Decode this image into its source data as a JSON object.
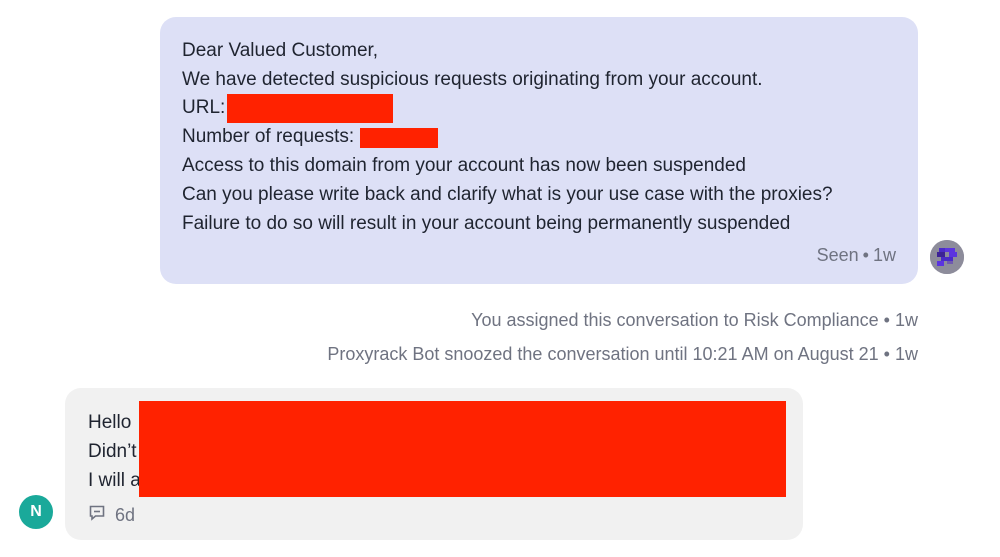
{
  "outgoing_message": {
    "lines": {
      "greeting": "Dear Valued Customer,",
      "detected": "We have detected suspicious requests originating from your account.",
      "url_label": "URL:",
      "requests_label": "Number of requests:",
      "suspended": "Access to this domain from your account has now been suspended",
      "question": "Can you please write back and clarify what is your use case with the proxies?",
      "warning": "Failure to do so will result in your account being permanently suspended"
    },
    "status": "Seen",
    "time": "1w"
  },
  "events": [
    {
      "text": "You assigned this conversation to Risk Compliance",
      "time": "1w"
    },
    {
      "text": "Proxyrack Bot snoozed the conversation until 10:21 AM on August 21",
      "time": "1w"
    }
  ],
  "incoming_message": {
    "line1_prefix": "Hello",
    "line2_prefix": "Didn’t",
    "line3_prefix": "I will a",
    "time": "6d"
  },
  "user_avatar": {
    "initial": "N",
    "color": "#1aa99a"
  },
  "colors": {
    "outgoing_bubble": "#dde0f6",
    "incoming_bubble": "#f1f1f1",
    "redaction": "#ff2200",
    "meta_text": "#6f7381"
  },
  "icons": {
    "bot_avatar": "bot-avatar-icon",
    "message_type": "chat-bubble-icon"
  }
}
